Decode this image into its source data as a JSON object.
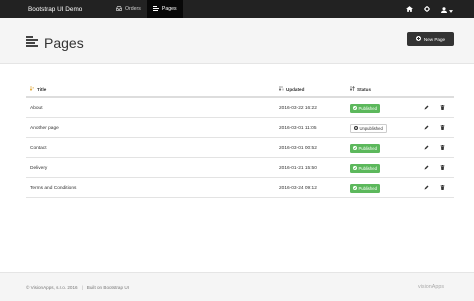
{
  "navbar": {
    "brand": "Bootstrap UI Demo",
    "items": [
      {
        "label": "Orders",
        "icon": "inbox-icon",
        "active": false
      },
      {
        "label": "Pages",
        "icon": "pages-icon",
        "active": true
      }
    ],
    "right_icons": [
      "home-icon",
      "gear-icon",
      "user-icon"
    ]
  },
  "header": {
    "title": "Pages",
    "title_icon": "list-icon",
    "new_button_label": "New Page"
  },
  "table": {
    "columns": [
      {
        "label": "Title",
        "sort_icon": "sort-alpha-icon"
      },
      {
        "label": "Updated",
        "sort_icon": "sort-numeric-icon"
      },
      {
        "label": "Status",
        "sort_icon": "sort-icon"
      }
    ],
    "rows": [
      {
        "title": "About",
        "updated": "2016-03-22 16:22",
        "status": "Published",
        "published": true
      },
      {
        "title": "Another page",
        "updated": "2016-03-01 11:05",
        "status": "Unpublished",
        "published": false
      },
      {
        "title": "Contact",
        "updated": "2016-03-01 00:52",
        "status": "Published",
        "published": true
      },
      {
        "title": "Delivery",
        "updated": "2016-01-21 15:50",
        "status": "Published",
        "published": true
      },
      {
        "title": "Terms and Conditions",
        "updated": "2016-03-24 09:12",
        "status": "Published",
        "published": true
      }
    ]
  },
  "footer": {
    "copyright": "© VisionApps, s.r.o. 2016",
    "built_on": "Built on Bootstrap UI",
    "logo_text": "visionApps"
  },
  "colors": {
    "navbar": "#222222",
    "published": "#5cb85c",
    "header_bg": "#f5f5f5",
    "sort_icon": "#e2a93b"
  }
}
